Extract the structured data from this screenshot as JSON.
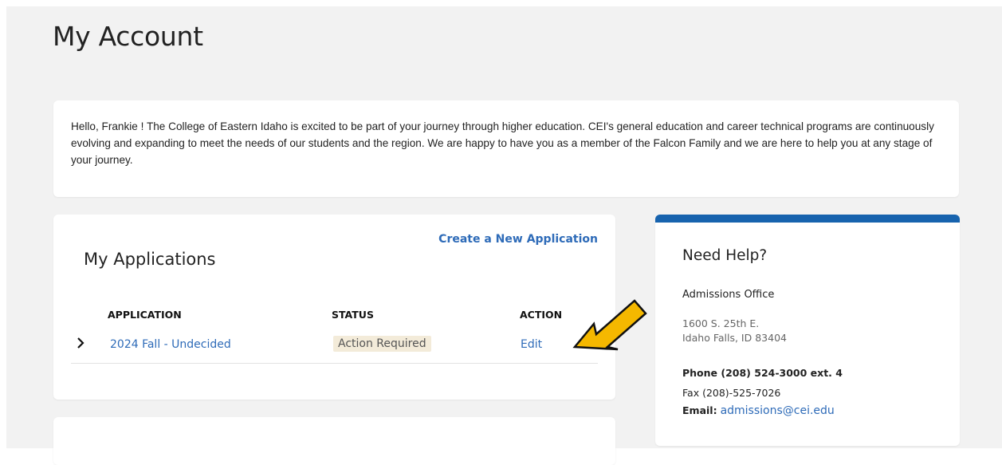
{
  "page": {
    "title": "My Account"
  },
  "welcome": {
    "text": "Hello, Frankie ! The College of Eastern Idaho is excited to be part of your journey through higher education. CEI's general education and career technical programs are continuously evolving and expanding to meet the needs of our students and the region. We are happy to have you as a member of the Falcon Family and we are here to help you at any stage of your journey."
  },
  "applications": {
    "title": "My Applications",
    "create_link": "Create a New Application",
    "columns": [
      "APPLICATION",
      "STATUS",
      "ACTION"
    ],
    "rows": [
      {
        "name": "2024 Fall - Undecided",
        "status": "Action Required",
        "action": "Edit"
      }
    ]
  },
  "help": {
    "title": "Need Help?",
    "office": "Admissions Office",
    "address_line1": "1600 S. 25th E.",
    "address_line2": "Idaho Falls, ID 83404",
    "phone": "Phone (208) 524-3000 ext. 4",
    "fax": "Fax (208)-525-7026",
    "email_label": "Email:",
    "email": "admissions@cei.edu"
  },
  "colors": {
    "link": "#2e6bb8",
    "accent_bar": "#1763ae",
    "status_badge_bg": "#f3ebd9",
    "annotation_arrow": "#f5b800"
  },
  "icons": {
    "expand": "chevron-right-icon",
    "annotation": "arrow-annotation-icon"
  }
}
